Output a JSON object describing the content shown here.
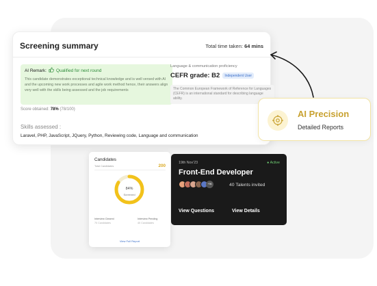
{
  "summary": {
    "title": "Screening summary",
    "time_label": "Total time taken:",
    "time_value": "64 mins",
    "remark_label": "AI Remark:",
    "remark_status": "Qualified for next round",
    "remark_body": "This candidate demonstrates exceptional technical knowledge and is well versed with AI and the upcoming new work processes and agile work method hence, their answers align very well with the skills being assessed and the job requirements",
    "score_label": "Score obtained:",
    "score_value": "78%",
    "score_detail": "(78/100)",
    "lang_heading": "Language & communication proficiency",
    "cefr_label": "CEFR grade: B2",
    "cefr_badge": "Independent User",
    "cefr_note": "The Common European Framework of Reference for Languages (CEFR) is an international standard for describing language ability.",
    "skills_title": "Skills assessed :",
    "skills_list": "Laravel, PHP, JavaScript, JQuery, Python, Reviewing code, Language and communication"
  },
  "ai_card": {
    "title": "AI Precision",
    "subtitle": "Detailed Reports",
    "icon": "target-icon",
    "accent": "#c8a12f"
  },
  "candidates": {
    "title": "Candidates",
    "sub": "Total Candidates",
    "count": "200",
    "screened_pct": "84%",
    "screened_label": "Screened",
    "screened_fraction": 0.84,
    "stat1_label": "Interview Cleared",
    "stat1_value": "70 Candidates",
    "stat2_label": "Interview Pending",
    "stat2_value": "40 Candidates",
    "link": "View Full Report"
  },
  "job": {
    "date": "19th Nov'23",
    "status": "Active",
    "role": "Front-End Developer",
    "avatar_more": "+96",
    "talents": "40 Talents invited",
    "btn_questions": "View Questions",
    "btn_details": "View Details"
  }
}
